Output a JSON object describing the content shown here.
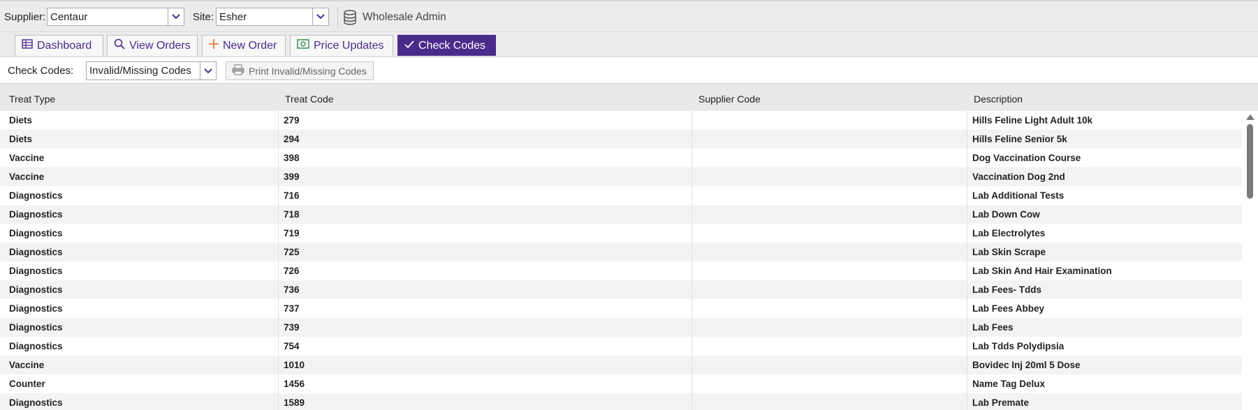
{
  "topbar": {
    "supplier_label": "Supplier:",
    "supplier_value": "Centaur",
    "site_label": "Site:",
    "site_value": "Esher",
    "admin_label": "Wholesale Admin",
    "admin_icon": "database-icon"
  },
  "tabs": [
    {
      "label": "Dashboard",
      "icon": "table-icon"
    },
    {
      "label": "View Orders",
      "icon": "search-icon"
    },
    {
      "label": "New Order",
      "icon": "plus-icon"
    },
    {
      "label": "Price Updates",
      "icon": "money-icon"
    },
    {
      "label": "Check Codes",
      "icon": "check-icon",
      "active": true
    }
  ],
  "toolbar": {
    "check_codes_label": "Check Codes:",
    "filter_value": "Invalid/Missing Codes",
    "print_label": "Print Invalid/Missing Codes"
  },
  "grid": {
    "columns": [
      "Treat Type",
      "Treat Code",
      "Supplier Code",
      "Description"
    ],
    "rows": [
      {
        "type": "Diets",
        "code": "279",
        "supplier_code": "",
        "description": "Hills Feline Light Adult 10k"
      },
      {
        "type": "Diets",
        "code": "294",
        "supplier_code": "",
        "description": "Hills Feline Senior 5k"
      },
      {
        "type": "Vaccine",
        "code": "398",
        "supplier_code": "",
        "description": "Dog Vaccination Course"
      },
      {
        "type": "Vaccine",
        "code": "399",
        "supplier_code": "",
        "description": "Vaccination Dog 2nd"
      },
      {
        "type": "Diagnostics",
        "code": "716",
        "supplier_code": "",
        "description": "Lab Additional Tests"
      },
      {
        "type": "Diagnostics",
        "code": "718",
        "supplier_code": "",
        "description": "Lab Down Cow"
      },
      {
        "type": "Diagnostics",
        "code": "719",
        "supplier_code": "",
        "description": "Lab Electrolytes"
      },
      {
        "type": "Diagnostics",
        "code": "725",
        "supplier_code": "",
        "description": "Lab Skin Scrape"
      },
      {
        "type": "Diagnostics",
        "code": "726",
        "supplier_code": "",
        "description": "Lab Skin And Hair Examination"
      },
      {
        "type": "Diagnostics",
        "code": "736",
        "supplier_code": "",
        "description": "Lab Fees- Tdds"
      },
      {
        "type": "Diagnostics",
        "code": "737",
        "supplier_code": "",
        "description": "Lab Fees Abbey"
      },
      {
        "type": "Diagnostics",
        "code": "739",
        "supplier_code": "",
        "description": "Lab Fees"
      },
      {
        "type": "Diagnostics",
        "code": "754",
        "supplier_code": "",
        "description": "Lab Tdds Polydipsia"
      },
      {
        "type": "Vaccine",
        "code": "1010",
        "supplier_code": "",
        "description": "Bovidec Inj 20ml 5 Dose"
      },
      {
        "type": "Counter",
        "code": "1456",
        "supplier_code": "",
        "description": "Name Tag Delux"
      },
      {
        "type": "Diagnostics",
        "code": "1589",
        "supplier_code": "",
        "description": "Lab Premate"
      }
    ]
  },
  "colors": {
    "accent": "#4a2a8a",
    "tab_text": "#4b2a8c"
  }
}
